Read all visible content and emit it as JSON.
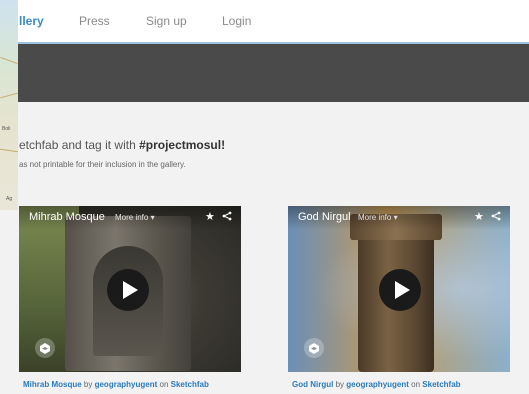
{
  "nav": {
    "items": [
      {
        "label": "llery",
        "active": true
      },
      {
        "label": "Press"
      },
      {
        "label": "Sign up"
      },
      {
        "label": "Login"
      }
    ]
  },
  "map": {
    "labels": [
      "Boli",
      "Ag"
    ]
  },
  "intro": {
    "title_prefix": "etchfab and tag it with ",
    "hashtag": "#projectmosul!",
    "subtitle": "as not printable for their inclusion in the gallery."
  },
  "cards": [
    {
      "title": "Mihrab Mosque",
      "more_info": "More info",
      "caption": {
        "model": "Mihrab Mosque",
        "by": "by",
        "author": "geographyugent",
        "on": "on",
        "platform": "Sketchfab"
      }
    },
    {
      "title": "God Nirgul",
      "more_info": "More info",
      "caption": {
        "model": "God Nirgul",
        "by": "by",
        "author": "geographyugent",
        "on": "on",
        "platform": "Sketchfab"
      }
    }
  ],
  "icons": {
    "star": "star-icon",
    "share": "share-icon",
    "play": "play-icon",
    "logo": "sketchfab-logo-icon"
  },
  "colors": {
    "link": "#2a7bbf",
    "nav_active": "#3a8bc8",
    "banner": "#4a4a4a"
  }
}
